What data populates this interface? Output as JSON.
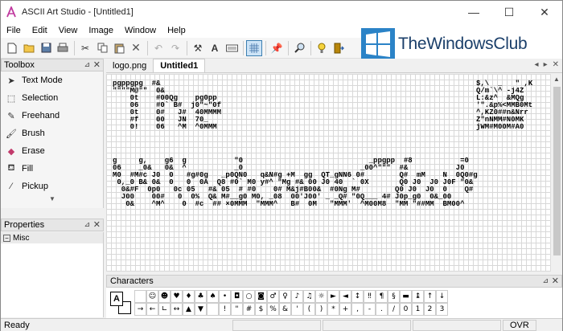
{
  "window": {
    "title": "ASCII Art Studio - [Untitled1]",
    "minimize": "—",
    "maximize": "☐",
    "close": "✕"
  },
  "menu": [
    "File",
    "Edit",
    "View",
    "Image",
    "Window",
    "Help"
  ],
  "toolbar_icons": [
    "new-file-icon",
    "open-folder-icon",
    "save-icon",
    "print-icon",
    "cut-icon",
    "copy-icon",
    "paste-icon",
    "delete-icon",
    "undo-icon",
    "redo-icon",
    "tools-icon",
    "text-icon",
    "keyboard-icon",
    "grid-icon",
    "pin-icon",
    "zoom-icon",
    "hint-icon",
    "exit-icon"
  ],
  "watermark": {
    "text": "TheWindowsClub"
  },
  "toolbox": {
    "title": "Toolbox",
    "tools": [
      {
        "label": "Text Mode",
        "icon": "cursor-icon"
      },
      {
        "label": "Selection",
        "icon": "selection-icon"
      },
      {
        "label": "Freehand",
        "icon": "pencil-icon"
      },
      {
        "label": "Brush",
        "icon": "brush-icon"
      },
      {
        "label": "Erase",
        "icon": "eraser-icon"
      },
      {
        "label": "Fill",
        "icon": "fill-icon"
      },
      {
        "label": "Pickup",
        "icon": "picker-icon"
      }
    ]
  },
  "properties": {
    "title": "Properties",
    "group": "Misc",
    "expander": "−"
  },
  "tabs": [
    {
      "label": "logo.png",
      "active": false
    },
    {
      "label": "Untitled1",
      "active": true
    }
  ],
  "tab_controls": {
    "prev": "◂",
    "next": "▸",
    "close": "✕"
  },
  "art_blocks": [
    "pgppgpg  #&\n\"\"\"\"M@\"\"  0&\n    0t    #00Qg    pg0pp\n    06    #0` B#  j0\"~\"0f\n    0t    0#   J#  40MMMM\n    #f    00   JN  70_\n    0!    06   ^M  ^0MMM",
    "$,\\  _   \" ,K\nQ/m`\\^ -j4Z\nL:&z^  &MQg\n'\".&p%<MMB0Mt\n^,KZ0##n&Nrr\nZ\"nNMM#N0MK\njWM#M00M#A0",
    "g     g,    g6  g           \"0                             _ppgpp  #8           =0\n06    _0&   0&  ^           _0                           _00^\"\"\"  #&           J0\nM0  #M#c J0  0   #g#0g   _p0QN0   q&N#g +M  gg  QT_gNN6 0#        Q#  mM    N  0Q0#g\n 0,_0 B& 0&  0   0  0A  Q8 #0` M0 y#^ \"Mg #& 00 J0 40  ` 0X       Q0 J0  J0 J0F \"0&\n  0&#F  0p0   0c 05   #& 05  # #0    0# M&j#B00&  #0Ng M#        Q0 J0  J0  0    Q#\n  J00    00#   0  0%  Q& M#__g0 M0, _08  00'J00' _ _Q# \"0Q___ 4# J0p_g0  0&_00\n   0&    ^M^    0  #c  ## ×0MMM  \"MMM^   B#  0M   \"MMM'  ^M00M8  \"MM \"##MM  BM00^"
  ],
  "characters": {
    "title": "Characters",
    "fg": "A",
    "rows": [
      [
        "",
        "☺",
        "☻",
        "♥",
        "♦",
        "♣",
        "♠",
        "•",
        "◘",
        "○",
        "◙",
        "♂",
        "♀",
        "♪",
        "♫",
        "☼",
        "►",
        "◄",
        "↕",
        "‼",
        "¶",
        "§",
        "▬",
        "↨",
        "↑",
        "↓",
        "→"
      ],
      [
        "←",
        "∟",
        "↔",
        "▲",
        "▼",
        "",
        "!",
        "\"",
        "#",
        "$",
        "%",
        "&",
        "'",
        "(",
        ")",
        "*",
        "+",
        ",",
        "-",
        ".",
        "/",
        "0",
        "1",
        "2",
        "3"
      ]
    ]
  },
  "status": {
    "text": "Ready",
    "mode": "OVR"
  }
}
